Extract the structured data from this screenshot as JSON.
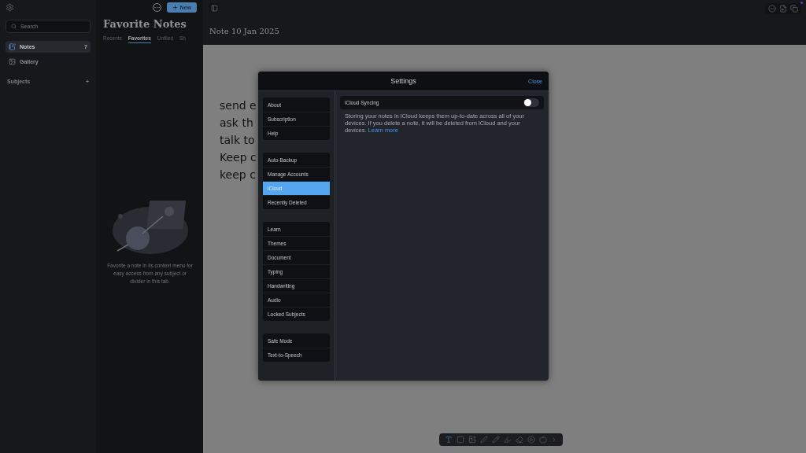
{
  "sidebar": {
    "search": {
      "placeholder": "Search"
    },
    "items": [
      {
        "label": "Notes",
        "count": "7",
        "selected": true
      },
      {
        "label": "Gallery",
        "selected": false
      }
    ],
    "section": {
      "label": "Subjects",
      "add": "+"
    }
  },
  "notes_panel": {
    "title": "Favorite Notes",
    "new_button": "New",
    "tabs": [
      {
        "label": "Recents",
        "selected": false
      },
      {
        "label": "Favorites",
        "selected": true
      },
      {
        "label": "Unfiled",
        "selected": false
      },
      {
        "label": "Sh",
        "selected": false
      }
    ],
    "empty_message": "Favorite a note in its context menu for easy access from any subject or divider in this tab."
  },
  "editor": {
    "note_title": "Note 10 Jan 2025",
    "lines": [
      "send e",
      "ask th",
      "talk to",
      "Keep c",
      "keep c"
    ]
  },
  "settings": {
    "title": "Settings",
    "close": "Close",
    "groups": [
      [
        {
          "label": "About",
          "selected": false
        },
        {
          "label": "Subscription",
          "selected": false
        },
        {
          "label": "Help",
          "selected": false
        }
      ],
      [
        {
          "label": "Auto-Backup",
          "selected": false
        },
        {
          "label": "Manage Accounts",
          "selected": false
        },
        {
          "label": "iCloud",
          "selected": true
        },
        {
          "label": "Recently Deleted",
          "selected": false
        }
      ],
      [
        {
          "label": "Learn",
          "selected": false
        },
        {
          "label": "Themes",
          "selected": false
        },
        {
          "label": "Document",
          "selected": false
        },
        {
          "label": "Typing",
          "selected": false
        },
        {
          "label": "Handwriting",
          "selected": false
        },
        {
          "label": "Audio",
          "selected": false
        },
        {
          "label": "Locked Subjects",
          "selected": false
        }
      ],
      [
        {
          "label": "Safe Mode",
          "selected": false
        },
        {
          "label": "Text-to-Speech",
          "selected": false
        }
      ]
    ],
    "icloud": {
      "label": "iCloud Syncing",
      "on": false,
      "description": "Storing your notes in iCloud keeps them up-to-date across all of your devices. If you delete a note, it will be deleted from iCloud and your devices.",
      "link": "Learn more"
    }
  }
}
